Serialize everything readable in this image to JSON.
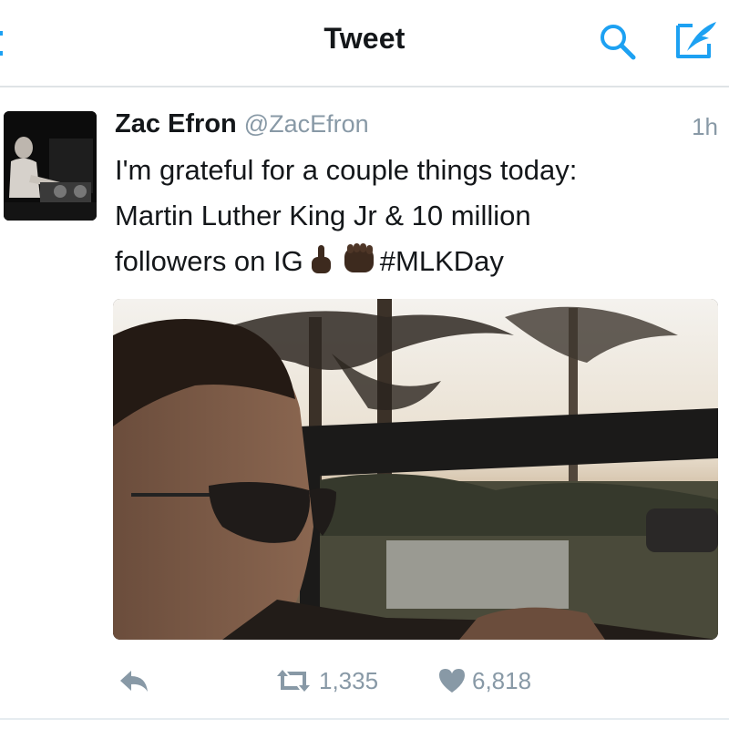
{
  "header": {
    "title": "Tweet",
    "accent_color": "#1da1f2",
    "icons": [
      "back-icon",
      "search-icon",
      "compose-icon"
    ]
  },
  "tweet": {
    "author_name": "Zac Efron",
    "author_handle": "@ZacEfron",
    "timestamp": "1h",
    "lines": [
      "I'm grateful for a couple things today:",
      "Martin Luther King Jr & 10 million",
      "followers on IG"
    ],
    "hashtag": "#MLKDay",
    "emojis": [
      "index-finger-up-emoji",
      "raised-fist-emoji"
    ]
  },
  "actions": {
    "retweet_count": "1,335",
    "like_count": "6,818",
    "icons": [
      "reply-icon",
      "retweet-icon",
      "like-icon"
    ]
  }
}
